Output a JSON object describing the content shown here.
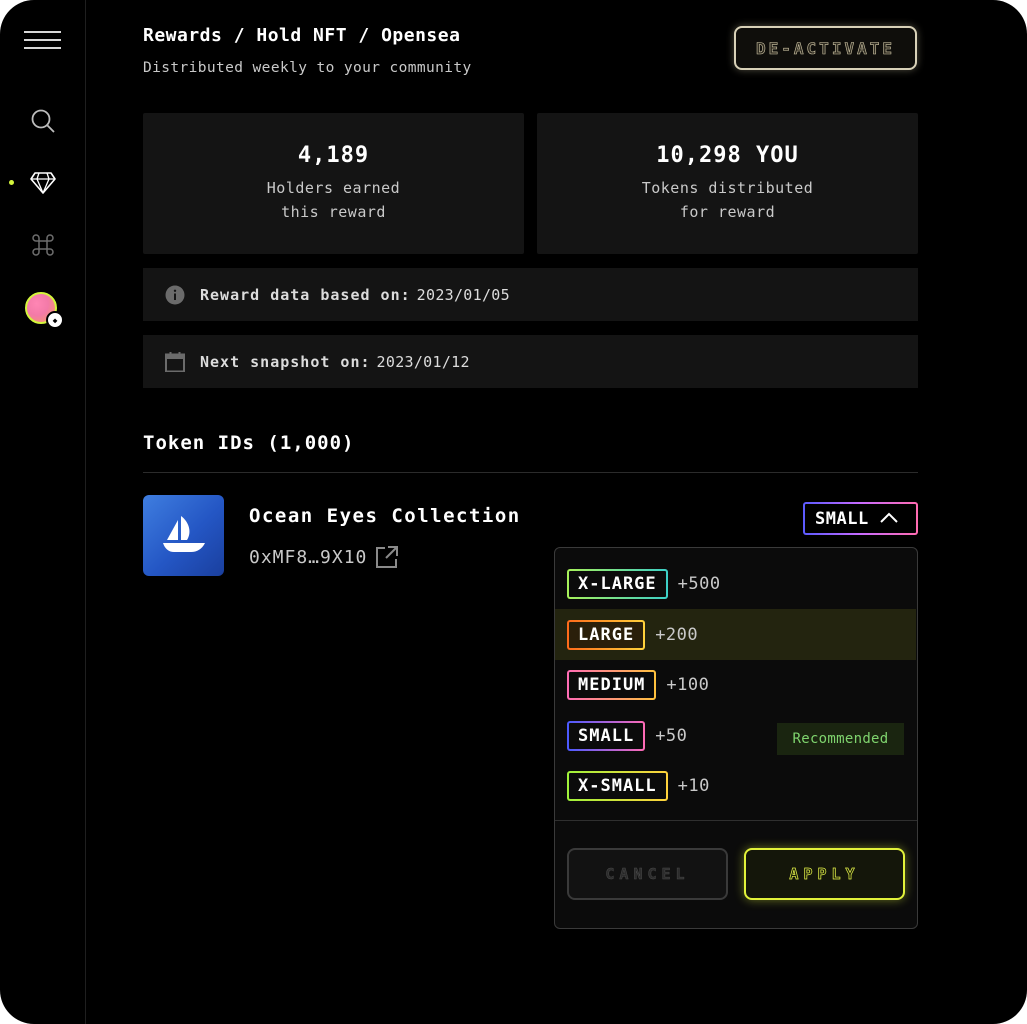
{
  "sidebar": {
    "items": [
      {
        "icon": "menu-icon"
      },
      {
        "icon": "search-icon"
      },
      {
        "icon": "diamond-icon",
        "active": true
      },
      {
        "icon": "command-icon"
      },
      {
        "icon": "avatar",
        "badge": "ethereum-icon"
      }
    ],
    "accent": "#d4f53c"
  },
  "header": {
    "breadcrumb": "Rewards / Hold NFT / Opensea",
    "subtitle": "Distributed weekly to your community",
    "deactivate_label": "DE-ACTIVATE"
  },
  "stats": [
    {
      "value": "4,189",
      "label_line1": "Holders earned",
      "label_line2": "this reward"
    },
    {
      "value": "10,298 YOU",
      "label_line1": "Tokens distributed",
      "label_line2": "for reward"
    }
  ],
  "info": {
    "reward_data_label": "Reward data based on:",
    "reward_data_value": "2023/01/05",
    "snapshot_label": "Next snapshot on:",
    "snapshot_value": "2023/01/12"
  },
  "tokens": {
    "title": "Token IDs (1,000)"
  },
  "collection": {
    "name": "Ocean Eyes Collection",
    "address": "0xMF8…9X10",
    "logo_icon": "opensea-ship-icon",
    "selected_size": "SMALL"
  },
  "dropdown": {
    "options": [
      {
        "label": "X-LARGE",
        "bonus": "+500"
      },
      {
        "label": "LARGE",
        "bonus": "+200",
        "highlighted": true
      },
      {
        "label": "MEDIUM",
        "bonus": "+100"
      },
      {
        "label": "SMALL",
        "bonus": "+50",
        "recommended": true
      },
      {
        "label": "X-SMALL",
        "bonus": "+10"
      }
    ],
    "recommended_label": "Recommended",
    "cancel_label": "CANCEL",
    "apply_label": "APPLY"
  },
  "colors": {
    "background": "#000000",
    "card": "#141414",
    "accent": "#e2f23a",
    "recommended_text": "#7fd46e"
  }
}
